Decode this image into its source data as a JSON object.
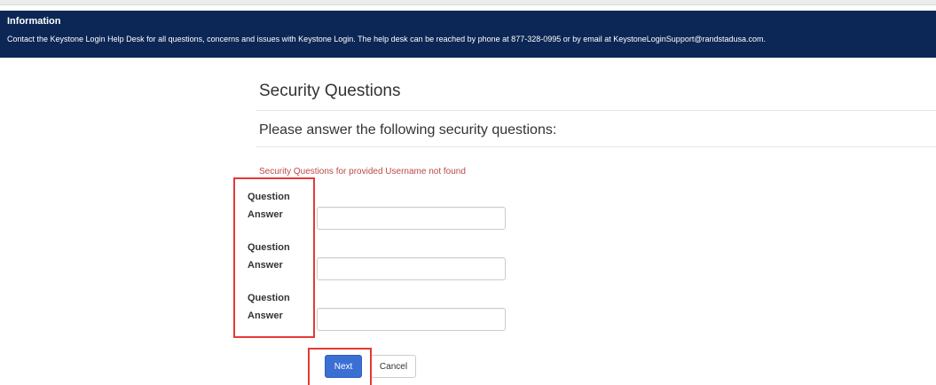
{
  "info": {
    "title": "Information",
    "text": "Contact the Keystone Login Help Desk for all questions, concerns and issues with Keystone Login. The help desk can be reached by phone at 877-328-0995 or by email at KeystoneLoginSupport@randstadusa.com."
  },
  "page": {
    "title": "Security Questions",
    "subtitle": "Please answer the following security questions:",
    "error": "Security Questions for provided Username not found"
  },
  "questions": [
    {
      "question_label": "Question",
      "answer_label": "Answer",
      "answer_value": ""
    },
    {
      "question_label": "Question",
      "answer_label": "Answer",
      "answer_value": ""
    },
    {
      "question_label": "Question",
      "answer_label": "Answer",
      "answer_value": ""
    }
  ],
  "actions": {
    "next_label": "Next",
    "cancel_label": "Cancel"
  },
  "colors": {
    "banner": "#0c2755",
    "error": "#b94a48",
    "primary_button": "#3b6fd4",
    "highlight": "#e53935"
  }
}
